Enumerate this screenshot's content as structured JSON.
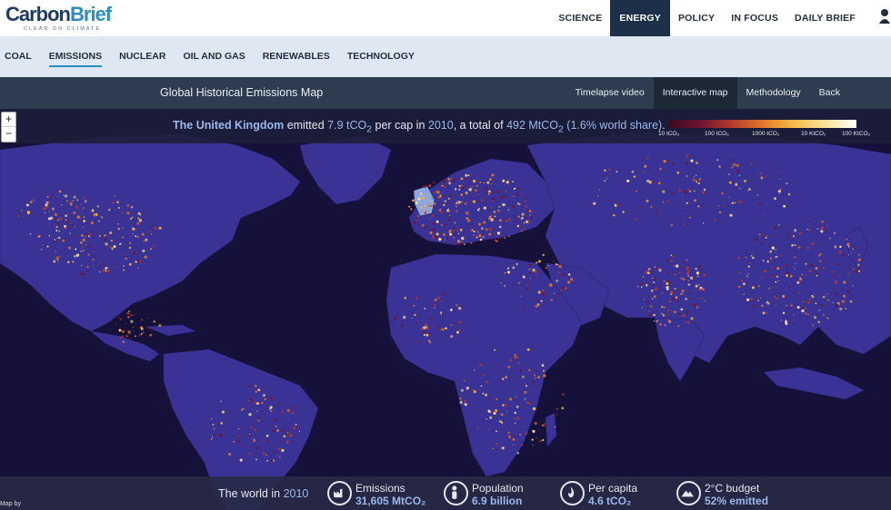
{
  "logo": {
    "name_a": "Carbon",
    "name_b": "Brief",
    "tagline": "CLEAR ON CLIMATE"
  },
  "main_nav": [
    {
      "label": "SCIENCE",
      "active": false
    },
    {
      "label": "ENERGY",
      "active": true
    },
    {
      "label": "POLICY",
      "active": false
    },
    {
      "label": "IN FOCUS",
      "active": false
    },
    {
      "label": "DAILY BRIEF",
      "active": false
    }
  ],
  "sub_nav": [
    {
      "label": "COAL",
      "active": false
    },
    {
      "label": "EMISSIONS",
      "active": true
    },
    {
      "label": "NUCLEAR",
      "active": false
    },
    {
      "label": "OIL AND GAS",
      "active": false
    },
    {
      "label": "RENEWABLES",
      "active": false
    },
    {
      "label": "TECHNOLOGY",
      "active": false
    }
  ],
  "map_bar": {
    "title": "Global Historical Emissions Map",
    "links": [
      {
        "label": "Timelapse video",
        "active": false
      },
      {
        "label": "Interactive map",
        "active": true
      },
      {
        "label": "Methodology",
        "active": false
      },
      {
        "label": "Back",
        "active": false
      }
    ]
  },
  "zoom": {
    "in": "+",
    "out": "−"
  },
  "headline": {
    "country": "The United Kingdom",
    "t1": " emitted ",
    "per_cap_value": "7.9 tCO",
    "per_cap_sub": "2",
    "t2": " per cap in ",
    "year": "2010",
    "t3": ", a total of ",
    "total_value": "492 MtCO",
    "total_sub": "2",
    "share": " (1.6% world share)",
    "t4": "."
  },
  "legend": {
    "ticks": [
      "10 tCO₂",
      "100 tCO₂",
      "1000 tCO₂",
      "10 KtCO₂",
      "100 KtCO₂"
    ],
    "colors": [
      "#3b0a1e",
      "#6e1530",
      "#b13a2a",
      "#e0772b",
      "#f5bb4a",
      "#fde39a",
      "#ffffff"
    ]
  },
  "stats": {
    "lead": "The world in ",
    "year": "2010",
    "items": [
      {
        "label": "Emissions",
        "value": "31,605 MtCO₂",
        "icon": "factory-icon"
      },
      {
        "label": "Population",
        "value": "6.9 billion",
        "icon": "person-icon"
      },
      {
        "label": "Per capita",
        "value": "4.6 tCO₂",
        "icon": "flame-icon"
      },
      {
        "label": "2°C budget",
        "value": "52% emitted",
        "icon": "mountain-icon"
      }
    ]
  },
  "credit": "Map by",
  "colors": {
    "ocean": "#16113a",
    "land": "#3a3395",
    "header_active": "#1e3049",
    "subnav_bg": "#dfe8f2",
    "accent": "#9bb8e8"
  }
}
